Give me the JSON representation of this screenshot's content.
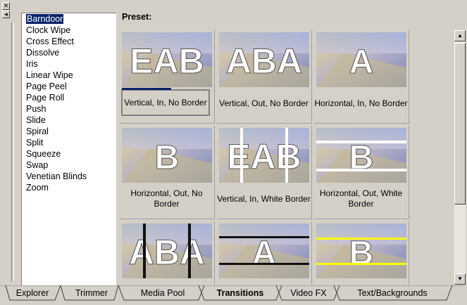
{
  "preset_label": "Preset:",
  "transitions": [
    "Barndoor",
    "Clock Wipe",
    "Cross Effect",
    "Dissolve",
    "Iris",
    "Linear Wipe",
    "Page Peel",
    "Page Roll",
    "Push",
    "Slide",
    "Spiral",
    "Split",
    "Squeeze",
    "Swap",
    "Venetian Blinds",
    "Zoom"
  ],
  "selected_transition": "Barndoor",
  "presets": [
    {
      "label": "Vertical, In, No Border",
      "letters": "EAB"
    },
    {
      "label": "Vertical, Out, No Border",
      "letters": "ABA"
    },
    {
      "label": "Horizontal, In, No Border",
      "letters": "A"
    },
    {
      "label": "Horizontal, Out, No Border",
      "letters": "B"
    },
    {
      "label": "Vertical, In, White Border",
      "letters": "EAB"
    },
    {
      "label": "Horizontal, Out, White Border",
      "letters": "B"
    },
    {
      "label": "",
      "letters": "ABA"
    },
    {
      "label": "",
      "letters": "A"
    },
    {
      "label": "",
      "letters": "B"
    }
  ],
  "selected_preset": 0,
  "tabs": [
    "Explorer",
    "Trimmer",
    "Media Pool",
    "Transitions",
    "Video FX",
    "Text/Backgrounds"
  ],
  "active_tab": "Transitions",
  "icons": {
    "close": "close-icon",
    "pin": "pin-icon",
    "scroll_up": "arrow-up-icon",
    "scroll_down": "arrow-down-icon"
  },
  "colors": {
    "selection": "#0a246a",
    "face": "#d4d0c8",
    "highlight_border": "#ffffff",
    "yellow_border": "#ffff00"
  }
}
